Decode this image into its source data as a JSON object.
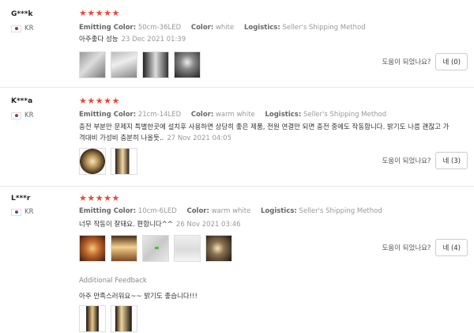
{
  "labels": {
    "emitting_color": "Emitting Color:",
    "color": "Color:",
    "logistics": "Logistics:",
    "helpful_question": "도움이 되었나요?",
    "additional_feedback": "Additional Feedback"
  },
  "reviews": [
    {
      "user": "G***k",
      "country": "KR",
      "rating": 5,
      "stars": "★★★★★",
      "emitting_color": "50cm-36LED",
      "color": "white",
      "logistics": "Seller's Shipping Method",
      "text": "아주좋다 성능",
      "date": "23 Dec 2021 01:39",
      "photos": [
        "photo-1",
        "photo-2",
        "photo-3",
        "photo-4"
      ],
      "helpful_button": "네 (0)"
    },
    {
      "user": "K***a",
      "country": "KR",
      "rating": 5,
      "stars": "★★★★★",
      "emitting_color": "21cm-14LED",
      "color": "warm white",
      "logistics": "Seller's Shipping Method",
      "text": "충전 부분만 문제지 특별한곳에 설치후 사용하면 상당히 좋은 제품, 전원 연결만 되면 충전 중에도 작동합니다. 밝기도 나름 괜찮고 가격대비 가성비 충분히 나올듯..",
      "date": "27 Nov 2021 04:05",
      "photos": [
        "photo-1",
        "photo-2"
      ],
      "helpful_button": "네 (3)"
    },
    {
      "user": "L***r",
      "country": "KR",
      "rating": 5,
      "stars": "★★★★★",
      "emitting_color": "10cm-6LED",
      "color": "warm white",
      "logistics": "Seller's Shipping Method",
      "text": "너무 작동이 잘돼요. 편합니다^^",
      "date": "26 Nov 2021 03:46",
      "photos": [
        "photo-1",
        "photo-2",
        "photo-3",
        "photo-4",
        "photo-5"
      ],
      "helpful_button": "네 (4)",
      "additional_feedback": {
        "text": "아주 만족스러워요~~ 밝기도 좋습니다!!!",
        "photos": [
          "photo-1",
          "photo-2"
        ]
      }
    }
  ]
}
